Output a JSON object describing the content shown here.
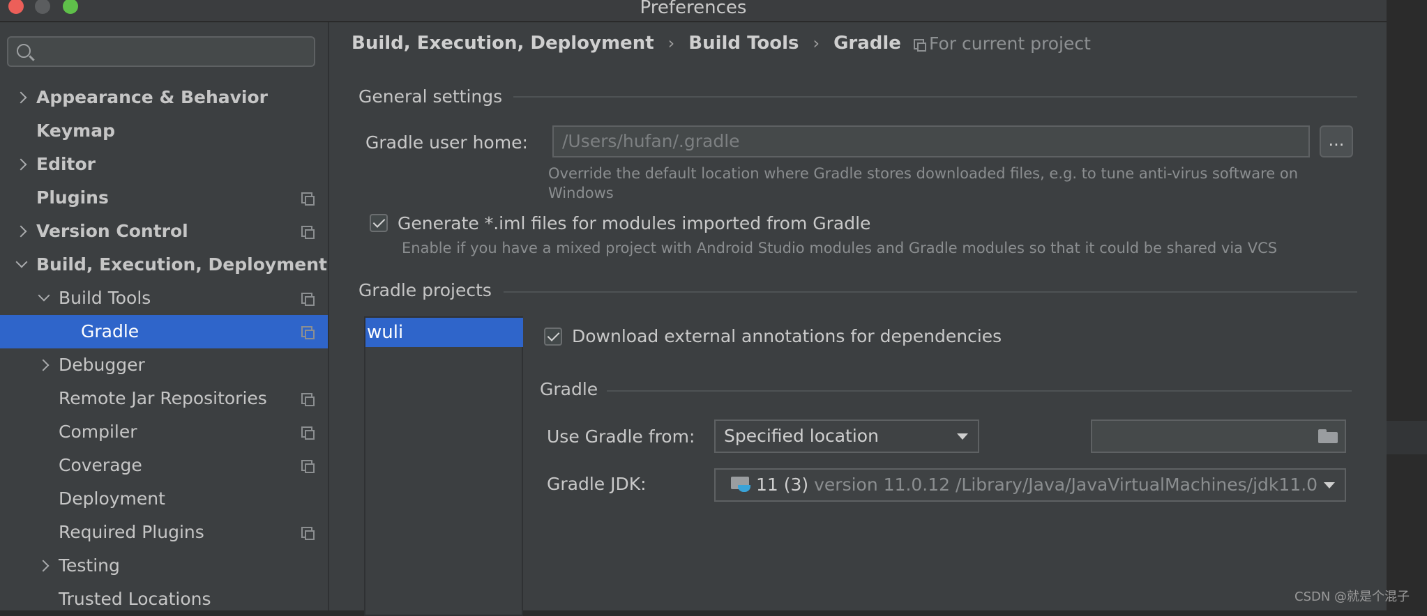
{
  "window": {
    "title": "Preferences"
  },
  "sidebar": {
    "search_placeholder": "",
    "items": [
      {
        "label": "Appearance & Behavior"
      },
      {
        "label": "Keymap"
      },
      {
        "label": "Editor"
      },
      {
        "label": "Plugins"
      },
      {
        "label": "Version Control"
      },
      {
        "label": "Build, Execution, Deployment"
      },
      {
        "label": "Build Tools"
      },
      {
        "label": "Gradle"
      },
      {
        "label": "Debugger"
      },
      {
        "label": "Remote Jar Repositories"
      },
      {
        "label": "Compiler"
      },
      {
        "label": "Coverage"
      },
      {
        "label": "Deployment"
      },
      {
        "label": "Required Plugins"
      },
      {
        "label": "Testing"
      },
      {
        "label": "Trusted Locations"
      }
    ]
  },
  "breadcrumb": {
    "items": [
      "Build, Execution, Deployment",
      "Build Tools",
      "Gradle"
    ],
    "separator": "›",
    "scope": "For current project"
  },
  "general": {
    "section_title": "General settings",
    "user_home_label": "Gradle user home:",
    "user_home_value": "/Users/hufan/.gradle",
    "browse_label": "...",
    "user_home_hint_line1": "Override the default location where Gradle stores downloaded files, e.g. to tune anti-virus software on",
    "user_home_hint_line2": "Windows",
    "iml_checkbox_label": "Generate *.iml files for modules imported from Gradle",
    "iml_checkbox_checked": true,
    "iml_hint": "Enable if you have a mixed project with Android Studio modules and Gradle modules so that it could be shared via VCS"
  },
  "projects": {
    "section_title": "Gradle projects",
    "list": [
      "wuli"
    ],
    "selected": "wuli",
    "download_annotations_label": "Download external annotations for dependencies",
    "download_annotations_checked": true,
    "gradle_section_title": "Gradle",
    "use_gradle_from_label": "Use Gradle from:",
    "use_gradle_from_value": "Specified location",
    "gradle_location_value": "",
    "gradle_jdk_label": "Gradle JDK:",
    "gradle_jdk_name": "11 (3)",
    "gradle_jdk_detail": "version 11.0.12 /Library/Java/JavaVirtualMachines/jdk11.0"
  },
  "watermark": "CSDN @就是个混子",
  "colors": {
    "selection": "#2f65ca",
    "background": "#3c3f41",
    "close": "#ec5f59",
    "maximize": "#5fc04a"
  }
}
